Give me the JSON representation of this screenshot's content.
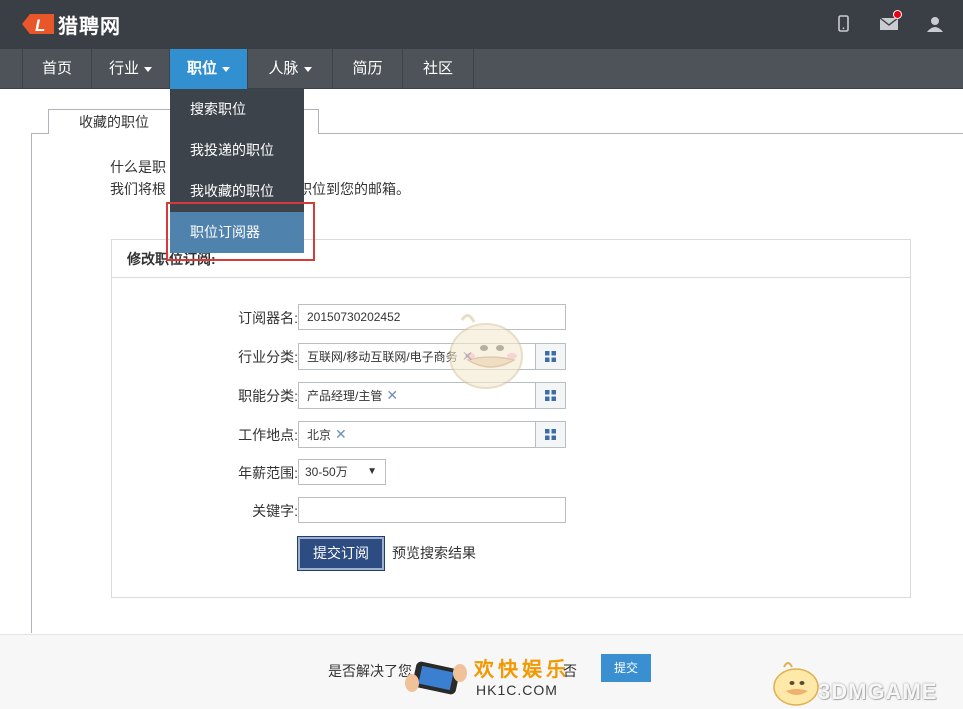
{
  "header": {
    "logo_letter": "L",
    "brand": "猎聘网"
  },
  "nav": {
    "items": [
      {
        "label": "首页",
        "has_caret": false,
        "active": false,
        "width": 70
      },
      {
        "label": "行业",
        "has_caret": true,
        "active": false,
        "width": 78
      },
      {
        "label": "职位",
        "has_caret": true,
        "active": true,
        "width": 78
      },
      {
        "label": "人脉",
        "has_caret": true,
        "active": false,
        "width": 85
      },
      {
        "label": "简历",
        "has_caret": false,
        "active": false,
        "width": 70
      },
      {
        "label": "社区",
        "has_caret": false,
        "active": false,
        "width": 71
      }
    ]
  },
  "dropdown": {
    "items": [
      "搜索职位",
      "我投递的职位",
      "我收藏的职位",
      "职位订阅器"
    ]
  },
  "tabs": {
    "favorites": "收藏的职位"
  },
  "intro": {
    "line1": "什么是职",
    "line2a": "我们将根",
    "line2b": "全新职位到您的邮箱。"
  },
  "panel": {
    "title": "修改职位订阅:",
    "fields": {
      "name_label": "订阅器名:",
      "name_value": "20150730202452",
      "industry_label": "行业分类:",
      "industry_value": "互联网/移动互联网/电子商务",
      "function_label": "职能分类:",
      "function_value": "产品经理/主管",
      "location_label": "工作地点:",
      "location_value": "北京",
      "salary_label": "年薪范围:",
      "salary_value": "30-50万",
      "keyword_label": "关键字:",
      "keyword_value": ""
    },
    "submit_label": "提交订阅",
    "preview_label": "预览搜索结果"
  },
  "bottom": {
    "question": "是否解决了您",
    "no": "否",
    "submit": "提交",
    "hk_title": "欢快娱乐",
    "hk_sub": "HK1C.COM",
    "brand": "3DMGAME"
  },
  "colors": {
    "topbar": "#3a3f45",
    "navbar": "#4d5359",
    "nav_active": "#3290d0",
    "dropdown": "#3d434a",
    "dropdown_highlight": "#4f82ad",
    "highlight_frame": "#d63b3b",
    "submit_button": "#2d4c82"
  }
}
